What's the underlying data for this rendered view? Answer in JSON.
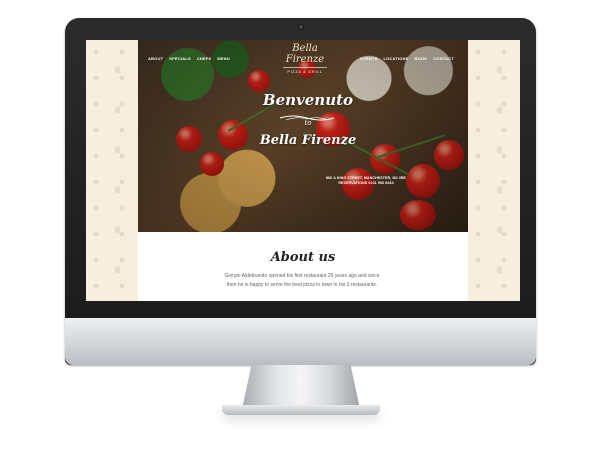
{
  "site": {
    "nav_left": [
      "ABOUT",
      "SPECIALS",
      "CHEFS",
      "MENU"
    ],
    "nav_right": [
      "EVENTS",
      "LOCATIONS",
      "BOOK",
      "CONTACT"
    ],
    "logo": {
      "name": "Bella Firenze",
      "subtitle": "PIZZA & GRILL"
    },
    "hero": {
      "welcome": "Benvenuto",
      "to": "to",
      "restaurant": "Bella Firenze",
      "address_line1": "866 A KING STREET, MANCHESTER, M2 3RE",
      "address_line2": "RESERVATIONS 0131 566 8464"
    },
    "about": {
      "heading": "About us",
      "text": "Giorgio Aldebrando opened his first restaurant 25 years ago and since then he is happy to serve the best pizza in town in his 3 restaurants."
    }
  },
  "colors": {
    "accent": "#e0261a",
    "cream": "#f6eede",
    "frame": "#1a1a1a"
  }
}
